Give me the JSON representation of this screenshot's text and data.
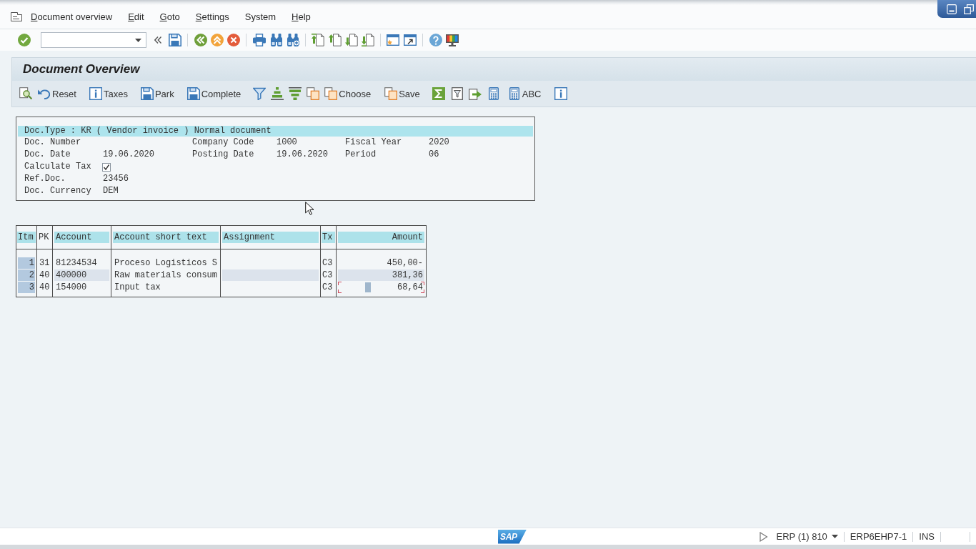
{
  "menu_bar": {
    "items": [
      {
        "label": "Document overview",
        "mnemonic": true
      },
      {
        "label": "Edit",
        "mnemonic": true
      },
      {
        "label": "Goto",
        "mnemonic": true
      },
      {
        "label": "Settings",
        "mnemonic": true
      },
      {
        "label": "System",
        "mnemonic": false
      },
      {
        "label": "Help",
        "mnemonic": true
      }
    ]
  },
  "screen_title": "Document Overview",
  "app_toolbar": {
    "buttons": [
      {
        "label": "Reset"
      },
      {
        "label": "Taxes"
      },
      {
        "label": "Park"
      },
      {
        "label": "Complete"
      },
      {
        "label": "Choose"
      },
      {
        "label": "Save"
      },
      {
        "label": "ABC"
      }
    ]
  },
  "header": {
    "doc_type_line": "Doc.Type : KR ( Vendor invoice ) Normal document",
    "rows": [
      [
        {
          "kind": "text",
          "label": "Doc. Number"
        },
        {
          "kind": "text",
          "label": "Company Code",
          "value": "1000"
        },
        {
          "kind": "text",
          "label": "Fiscal Year",
          "value": "2020"
        }
      ],
      [
        {
          "kind": "text",
          "label": "Doc. Date",
          "value": "19.06.2020"
        },
        {
          "kind": "text",
          "label": "Posting Date",
          "value": "19.06.2020"
        },
        {
          "kind": "text",
          "label": "Period",
          "value": "06"
        }
      ],
      [
        {
          "kind": "checkbox",
          "label": "Calculate Tax",
          "checked": true
        }
      ],
      [
        {
          "kind": "text",
          "label": "Ref.Doc.",
          "value": "23456"
        }
      ],
      [
        {
          "kind": "text",
          "label": "Doc. Currency",
          "value": "DEM"
        }
      ]
    ]
  },
  "items_table": {
    "columns": [
      {
        "label": "Itm",
        "highlighted": true
      },
      {
        "label": "PK",
        "highlighted": false
      },
      {
        "label": "Account",
        "highlighted": true
      },
      {
        "label": "Account short text",
        "highlighted": true
      },
      {
        "label": "Assignment",
        "highlighted": true
      },
      {
        "label": "Tx",
        "highlighted": true
      },
      {
        "label": "Amount",
        "highlighted": true
      }
    ],
    "rows": [
      {
        "itm": "1",
        "pk": "31",
        "account": "81234534",
        "short_text": "Proceso Logisticos S",
        "tx": "C3",
        "amount": "450,00-",
        "focused": false
      },
      {
        "itm": "2",
        "pk": "40",
        "account": "400000",
        "short_text": "Raw materials consum",
        "tx": "C3",
        "amount": "381,36",
        "focused": false
      },
      {
        "itm": "3",
        "pk": "40",
        "account": "154000",
        "short_text": "Input tax",
        "tx": "C3",
        "amount": "68,64",
        "focused": true
      }
    ]
  },
  "status_bar": {
    "logo": "SAP",
    "system": "ERP (1) 810",
    "server": "ERP6EHP7-1",
    "mode": "INS"
  }
}
